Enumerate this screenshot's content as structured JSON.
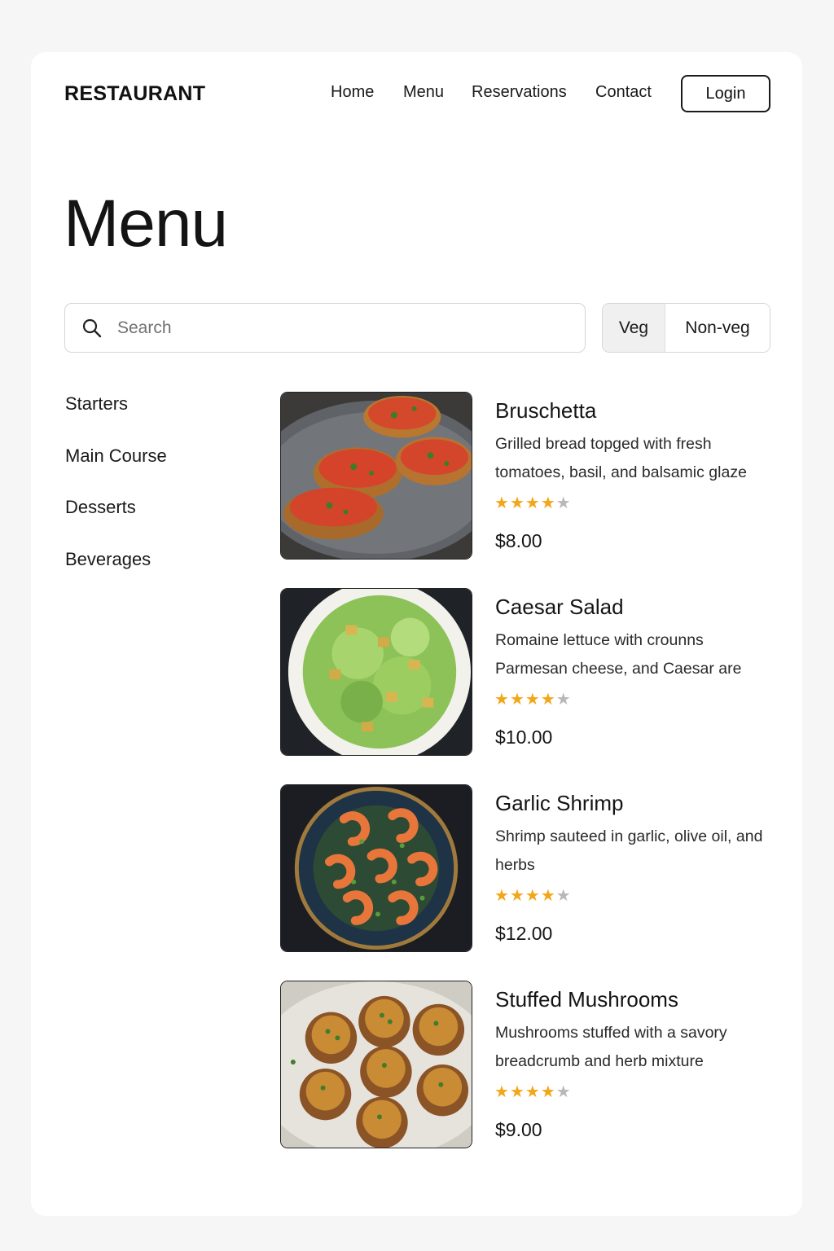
{
  "header": {
    "brand": "RESTAURANT",
    "nav": [
      "Home",
      "Menu",
      "Reservations",
      "Contact"
    ],
    "login_label": "Login"
  },
  "page_title": "Menu",
  "search": {
    "placeholder": "Search",
    "value": ""
  },
  "filter": {
    "options": [
      "Veg",
      "Non-veg"
    ],
    "selected": "Veg"
  },
  "categories": [
    "Starters",
    "Main Course",
    "Desserts",
    "Beverages"
  ],
  "items": [
    {
      "name": "Bruschetta",
      "description": "Grilled bread topged with fresh tomatoes, basil, and balsamic glaze",
      "rating": 4,
      "rating_max": 5,
      "price": "$8.00",
      "image": "bruschetta-photo"
    },
    {
      "name": "Caesar Salad",
      "description": "Romaine lettuce with crounns Parmesan cheese, and Caesar are",
      "rating": 4,
      "rating_max": 5,
      "price": "$10.00",
      "image": "caesar-salad-photo"
    },
    {
      "name": "Garlic Shrimp",
      "description": "Shrimp sauteed in garlic, olive oil, and herbs",
      "rating": 4,
      "rating_max": 5,
      "price": "$12.00",
      "image": "garlic-shrimp-photo"
    },
    {
      "name": "Stuffed Mushrooms",
      "description": "Mushrooms stuffed with a savory breadcrumb and herb mixture",
      "rating": 4,
      "rating_max": 5,
      "price": "$9.00",
      "image": "stuffed-mushrooms-photo"
    }
  ],
  "colors": {
    "background": "#f6f6f6",
    "card": "#ffffff",
    "text": "#1a1a1a",
    "star_filled": "#f2a618",
    "star_empty": "#b8b8b8",
    "toggle_selected": "#f0f0f0"
  }
}
